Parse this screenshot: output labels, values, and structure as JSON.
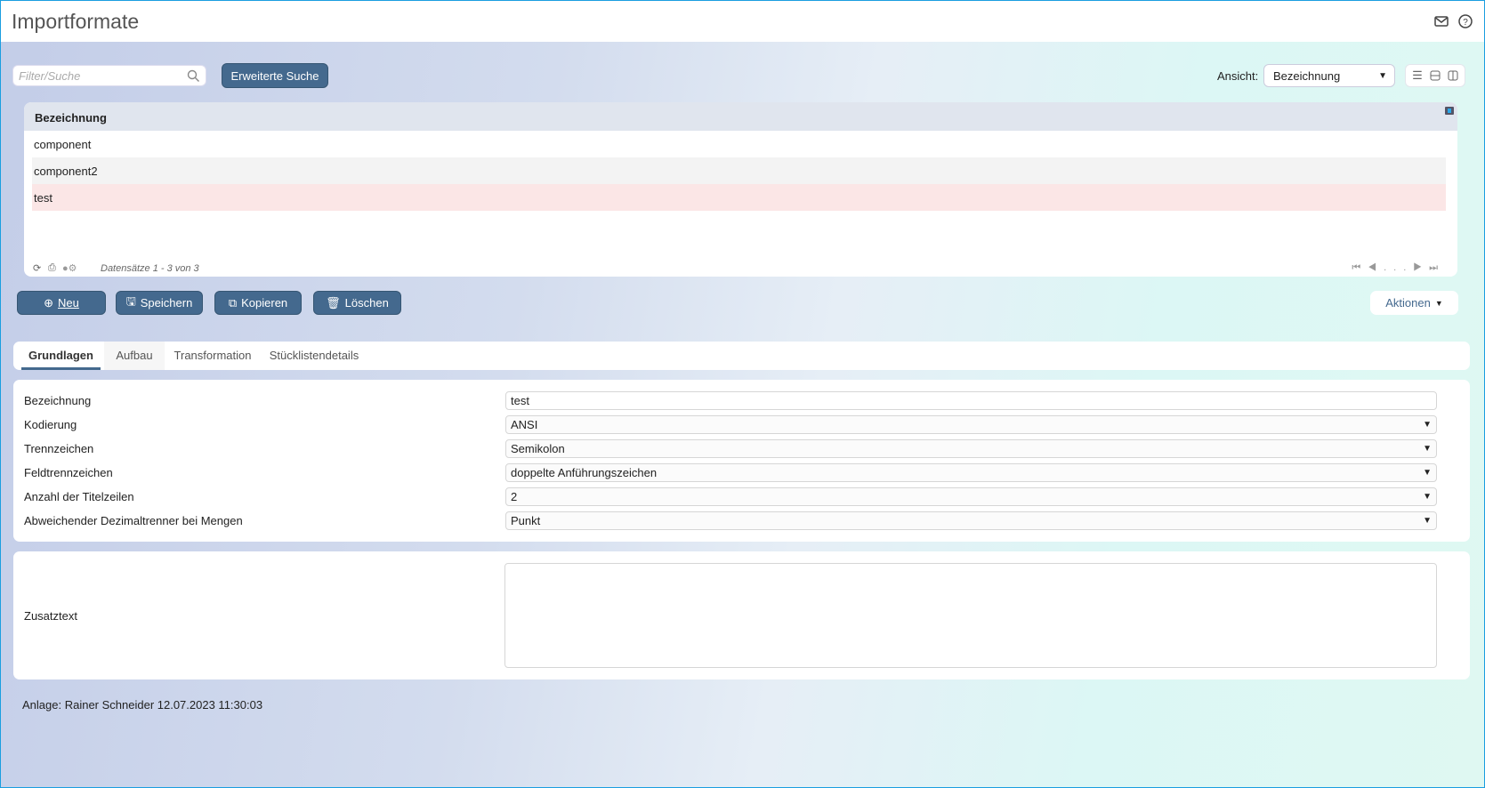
{
  "header": {
    "title": "Importformate",
    "icons": [
      "mail-icon",
      "help-icon"
    ]
  },
  "toolbar": {
    "search_placeholder": "Filter/Suche",
    "advanced_search": "Erweiterte Suche",
    "view_label": "Ansicht:",
    "view_value": "Bezeichnung"
  },
  "grid": {
    "column": "Bezeichnung",
    "rows": [
      "component",
      "component2",
      "test"
    ],
    "selected": 2,
    "footer": "Datensätze 1 - 3 von 3",
    "pager_ellipsis": "..."
  },
  "actions": {
    "new": "Neu",
    "save": "Speichern",
    "copy": "Kopieren",
    "delete": "Löschen",
    "more": "Aktionen"
  },
  "tabs": [
    "Grundlagen",
    "Aufbau",
    "Transformation",
    "Stücklistendetails"
  ],
  "form": {
    "fields": [
      {
        "label": "Bezeichnung",
        "value": "test"
      },
      {
        "label": "Kodierung",
        "value": "ANSI"
      },
      {
        "label": "Trennzeichen",
        "value": "Semikolon"
      },
      {
        "label": "Feldtrennzeichen",
        "value": "doppelte Anführungszeichen"
      },
      {
        "label": "Anzahl der Titelzeilen",
        "value": "2"
      },
      {
        "label": "Abweichender Dezimaltrenner bei Mengen",
        "value": "Punkt"
      }
    ],
    "notes_label": "Zusatztext",
    "notes_value": ""
  },
  "meta": "Anlage: Rainer Schneider 12.07.2023 11:30:03",
  "colors": {
    "button": "#44698e",
    "selected_row": "#fbe6e6",
    "border": "#1a9ee0"
  }
}
